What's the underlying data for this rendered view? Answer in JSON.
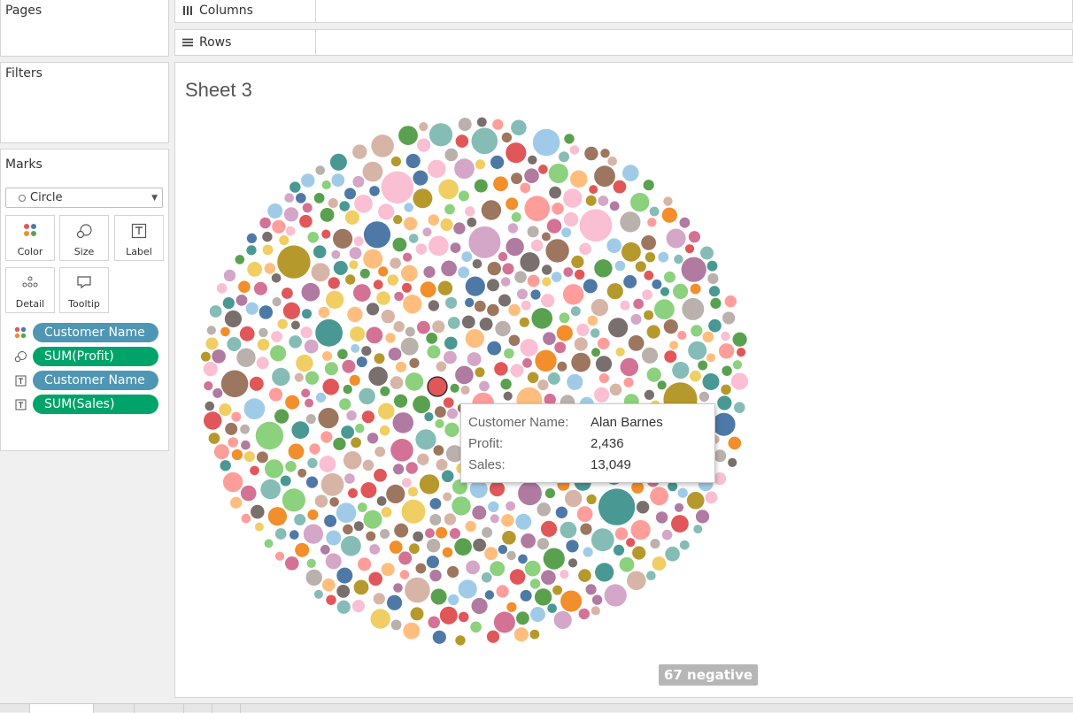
{
  "panels": {
    "pages": "Pages",
    "filters": "Filters",
    "marks": "Marks"
  },
  "shelves": {
    "columns": "Columns",
    "rows": "Rows"
  },
  "marks": {
    "mark_type": "Circle",
    "buttons": [
      "Color",
      "Size",
      "Label",
      "Detail",
      "Tooltip"
    ],
    "fields": [
      {
        "encoding": "color",
        "icon": "color-dots-icon",
        "label": "Customer Name",
        "kind": "dimension"
      },
      {
        "encoding": "size",
        "icon": "size-icon",
        "label": "SUM(Profit)",
        "kind": "measure"
      },
      {
        "encoding": "label",
        "icon": "text-icon",
        "label": "Customer Name",
        "kind": "dimension"
      },
      {
        "encoding": "label",
        "icon": "text-icon",
        "label": "SUM(Sales)",
        "kind": "measure"
      }
    ]
  },
  "sheet": {
    "title": "Sheet 3"
  },
  "tooltip": {
    "rows": [
      {
        "key": "Customer Name:",
        "value": "Alan Barnes"
      },
      {
        "key": "Profit:",
        "value": "2,436"
      },
      {
        "key": "Sales:",
        "value": "13,049"
      }
    ]
  },
  "badge": "67 negative",
  "palette": [
    "#4e79a7",
    "#a0cbe8",
    "#f28e2b",
    "#ffbe7d",
    "#59a14f",
    "#8cd17d",
    "#b6992d",
    "#f1ce63",
    "#499894",
    "#86bcb6",
    "#e15759",
    "#ff9d9a",
    "#79706e",
    "#bab0ac",
    "#d37295",
    "#fabfd2",
    "#b07aa1",
    "#d4a6c8",
    "#9d7660",
    "#d7b5a6"
  ],
  "chart_data": {
    "type": "bubble",
    "color_by": "Customer Name",
    "size_by": "SUM(Profit)",
    "highlighted": {
      "customer": "Alan Barnes",
      "profit": 2436,
      "sales": 13049
    }
  }
}
